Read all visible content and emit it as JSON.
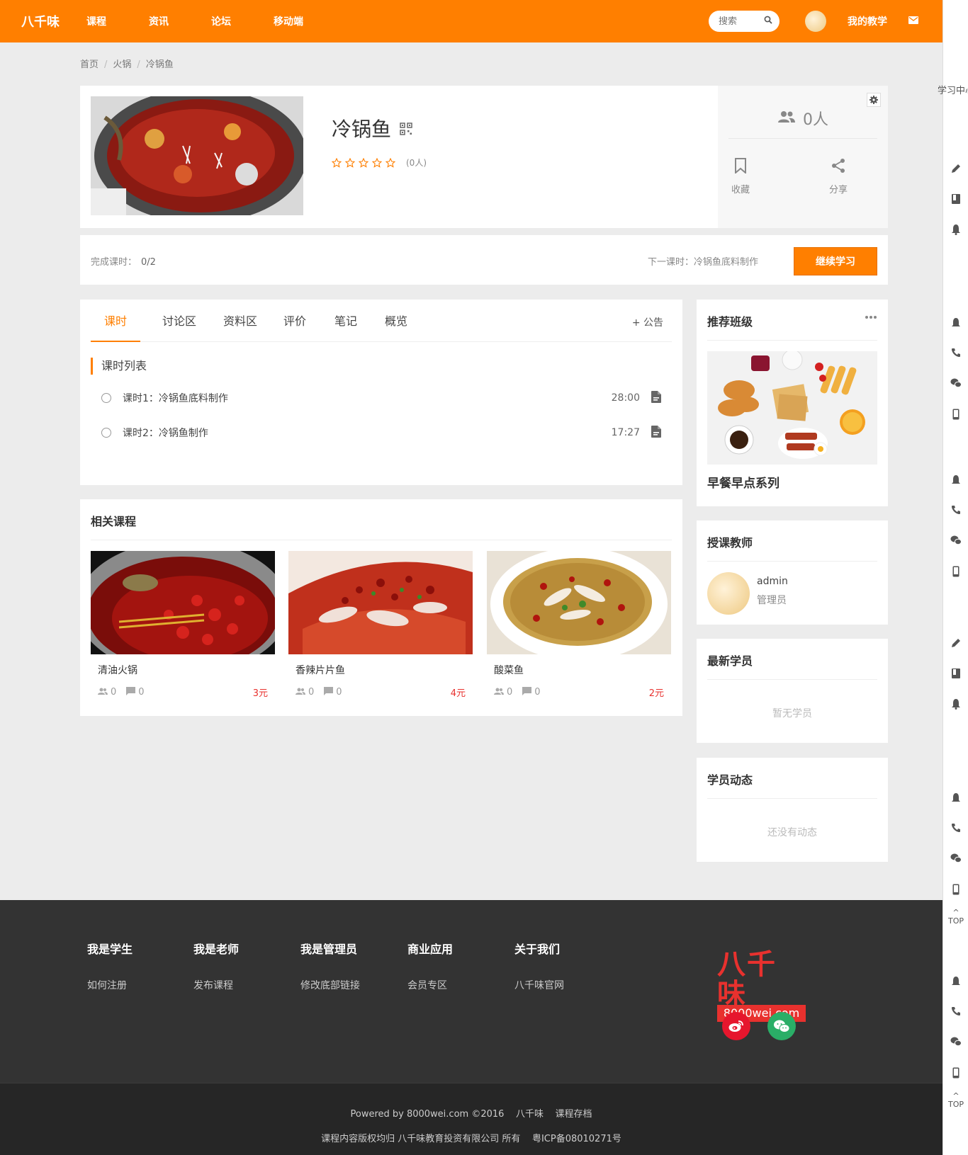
{
  "nav": {
    "logo": "八千味",
    "links": [
      "课程",
      "资讯",
      "论坛",
      "移动端"
    ],
    "search_placeholder": "搜索",
    "my_teaching": "我的教学"
  },
  "sidebar": {
    "study_center": [
      "学",
      "习",
      "中",
      "心"
    ],
    "top_label": "TOP"
  },
  "breadcrumb": [
    "首页",
    "火锅",
    "冷锅鱼"
  ],
  "course": {
    "title": "冷锅鱼",
    "rating_count": "(0人)",
    "rating_stars": 0,
    "students": "0人",
    "favorite": "收藏",
    "share": "分享"
  },
  "progress": {
    "done_label": "完成课时：",
    "done_value": "0/2",
    "next_label": "下一课时：冷锅鱼底料制作",
    "continue": "继续学习"
  },
  "tabs": {
    "items": [
      "课时",
      "讨论区",
      "资料区",
      "评价",
      "笔记",
      "概览"
    ],
    "active": 0,
    "notice": "+ 公告"
  },
  "lessons": {
    "heading": "课时列表",
    "items": [
      {
        "title": "课时1：冷锅鱼底料制作",
        "duration": "28:00"
      },
      {
        "title": "课时2：冷锅鱼制作",
        "duration": "17:27"
      }
    ]
  },
  "related": {
    "heading": "相关课程",
    "items": [
      {
        "name": "清油火锅",
        "students": "0",
        "comments": "0",
        "price": "3元"
      },
      {
        "name": "香辣片片鱼",
        "students": "0",
        "comments": "0",
        "price": "4元"
      },
      {
        "name": "酸菜鱼",
        "students": "0",
        "comments": "0",
        "price": "2元"
      }
    ]
  },
  "widgets": {
    "recommend": {
      "title": "推荐班级",
      "class_name": "早餐早点系列"
    },
    "teacher": {
      "title": "授课教师",
      "name": "admin",
      "role": "管理员"
    },
    "students": {
      "title": "最新学员",
      "empty": "暂无学员"
    },
    "activity": {
      "title": "学员动态",
      "empty": "还没有动态"
    }
  },
  "footer": {
    "cols": [
      {
        "head": "我是学生",
        "link": "如何注册"
      },
      {
        "head": "我是老师",
        "link": "发布课程"
      },
      {
        "head": "我是管理员",
        "link": "修改底部链接"
      },
      {
        "head": "商业应用",
        "link": "会员专区"
      },
      {
        "head": "关于我们",
        "link": "八千味官网"
      }
    ],
    "brand_big": "八千味",
    "brand_url": "8000wei.com",
    "powered": "Powered by 8000wei.com ©2016",
    "powered_link1": "八千味",
    "powered_link2": "课程存档",
    "copyright": "课程内容版权均归 八千味教育投资有限公司 所有",
    "icp": "粤ICP备08010271号"
  },
  "colors": {
    "accent": "#ff7f00",
    "price": "#e8312e",
    "weibo": "#e6162d",
    "wechat": "#2aae67"
  }
}
